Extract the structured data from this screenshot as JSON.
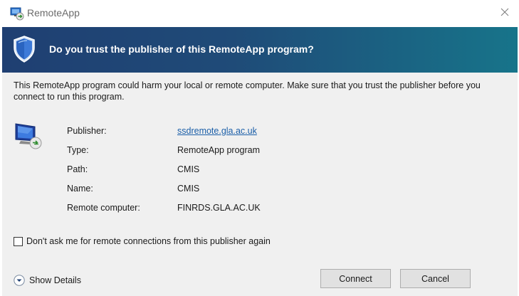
{
  "window": {
    "title": "RemoteApp",
    "app_icon": "remoteapp-icon",
    "close_icon": "close-icon"
  },
  "banner": {
    "icon": "shield-icon",
    "question": "Do you trust the publisher of this RemoteApp program?"
  },
  "warning_text": "This RemoteApp program could harm your local or remote computer. Make sure that you trust the publisher before you connect to run this program.",
  "details": {
    "icon": "remote-computer-icon",
    "fields": [
      {
        "label": "Publisher:",
        "value": "ssdremote.gla.ac.uk",
        "is_link": true
      },
      {
        "label": "Type:",
        "value": "RemoteApp program"
      },
      {
        "label": "Path:",
        "value": "CMIS"
      },
      {
        "label": "Name:",
        "value": "CMIS"
      },
      {
        "label": "Remote computer:",
        "value": "FINRDS.GLA.AC.UK"
      }
    ]
  },
  "checkbox": {
    "label": "Don't ask me for remote connections from this publisher again",
    "checked": false
  },
  "show_details_label": "Show Details",
  "buttons": {
    "connect": "Connect",
    "cancel": "Cancel"
  },
  "colors": {
    "banner_start": "#1f3f72",
    "banner_end": "#17748a",
    "link": "#1a5ea8",
    "content_bg": "#f0f0f0"
  }
}
